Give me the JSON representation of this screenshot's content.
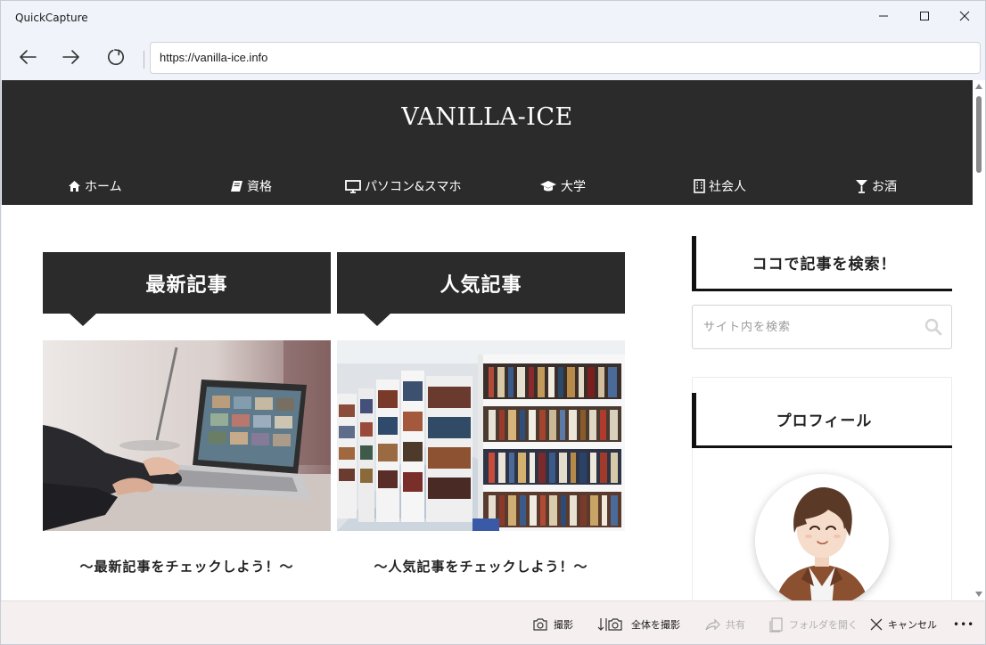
{
  "window": {
    "title": "QuickCapture"
  },
  "browser": {
    "url": "https://vanilla-ice.info"
  },
  "site": {
    "title": "VANILLA-ICE",
    "nav": [
      {
        "label": "ホーム",
        "icon": "home-icon"
      },
      {
        "label": "資格",
        "icon": "book-icon"
      },
      {
        "label": "パソコン&スマホ",
        "icon": "monitor-icon"
      },
      {
        "label": "大学",
        "icon": "graduation-cap-icon"
      },
      {
        "label": "社会人",
        "icon": "building-icon"
      },
      {
        "label": "お酒",
        "icon": "cocktail-glass-icon"
      }
    ],
    "tabs": [
      {
        "label": "最新記事",
        "caption": "〜最新記事をチェックしよう！〜"
      },
      {
        "label": "人気記事",
        "caption": "〜人気記事をチェックしよう！〜"
      }
    ],
    "sidebar": {
      "search_title": "ココで記事を検索！",
      "search_placeholder": "サイト内を検索",
      "profile_title": "プロフィール"
    }
  },
  "bottombar": {
    "capture": "撮影",
    "full_capture": "全体を撮影",
    "share": "共有",
    "open_folder": "フォルダを開く",
    "cancel": "キャンセル",
    "more": "•••"
  },
  "colors": {
    "header_bg": "#2b2b2b",
    "accent_dark": "#111111",
    "bottombar_bg": "#f5efef"
  }
}
